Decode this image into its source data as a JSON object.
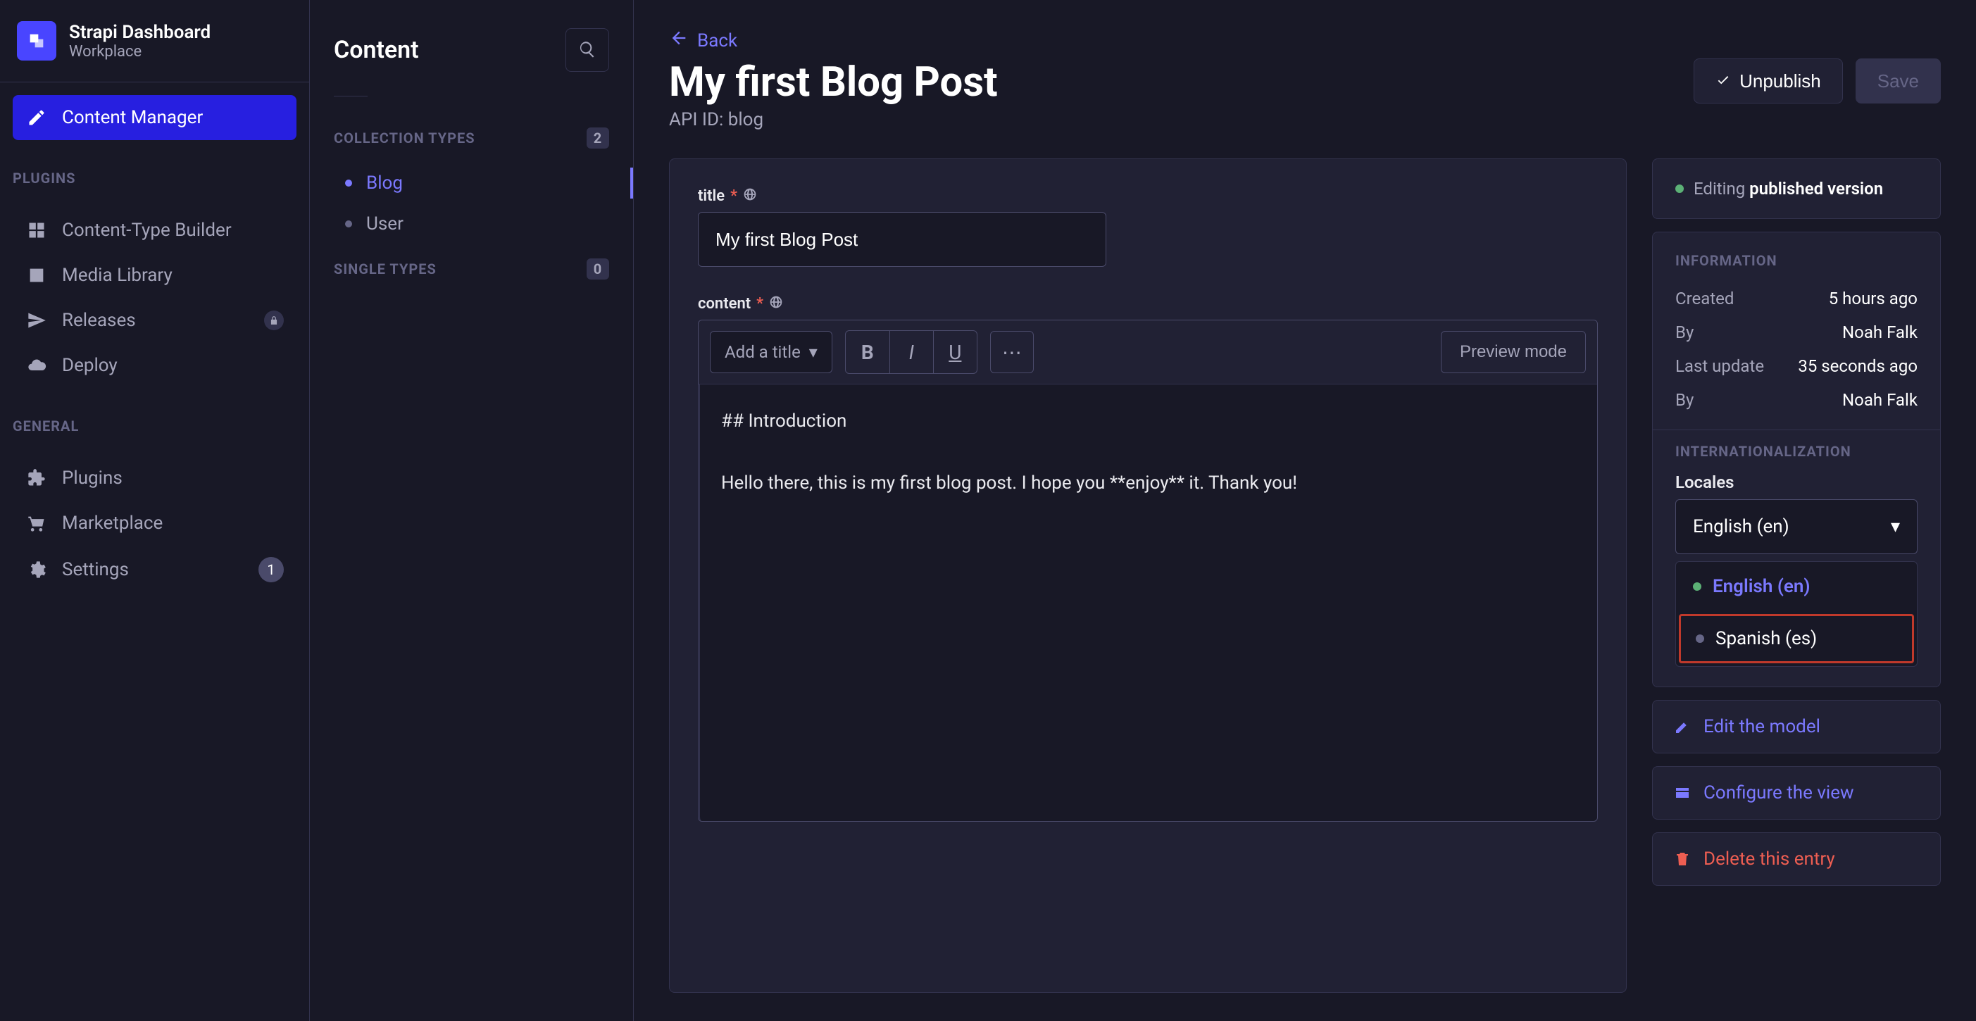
{
  "brand": {
    "title": "Strapi Dashboard",
    "subtitle": "Workplace"
  },
  "mainNav": {
    "contentManager": "Content Manager",
    "sections": {
      "plugins": "PLUGINS",
      "general": "GENERAL"
    },
    "items": {
      "contentTypeBuilder": "Content-Type Builder",
      "mediaLibrary": "Media Library",
      "releases": "Releases",
      "deploy": "Deploy",
      "plugins": "Plugins",
      "marketplace": "Marketplace",
      "settings": "Settings"
    },
    "settingsBadge": "1"
  },
  "secSidebar": {
    "title": "Content",
    "groups": {
      "collection": {
        "label": "COLLECTION TYPES",
        "count": "2"
      },
      "single": {
        "label": "SINGLE TYPES",
        "count": "0"
      }
    },
    "collectionItems": {
      "blog": "Blog",
      "user": "User"
    }
  },
  "page": {
    "back": "Back",
    "title": "My first Blog Post",
    "apiId": "API ID: blog",
    "unpublish": "Unpublish",
    "save": "Save"
  },
  "form": {
    "titleField": {
      "label": "title",
      "value": "My first Blog Post"
    },
    "contentField": {
      "label": "content"
    },
    "toolbar": {
      "titleSelect": "Add a title",
      "preview": "Preview mode"
    },
    "body": "## Introduction\n\nHello there, this is my first blog post. I hope you **enjoy** it. Thank you!"
  },
  "status": {
    "editing": "Editing",
    "published": "published version"
  },
  "info": {
    "heading": "INFORMATION",
    "created": {
      "label": "Created",
      "value": "5 hours ago"
    },
    "by1": {
      "label": "By",
      "value": "Noah Falk"
    },
    "lastUpdate": {
      "label": "Last update",
      "value": "35 seconds ago"
    },
    "by2": {
      "label": "By",
      "value": "Noah Falk"
    }
  },
  "i18n": {
    "heading": "INTERNATIONALIZATION",
    "localesLabel": "Locales",
    "selected": "English (en)",
    "options": {
      "en": "English (en)",
      "es": "Spanish (es)"
    }
  },
  "actions": {
    "editModel": "Edit the model",
    "configureView": "Configure the view",
    "deleteEntry": "Delete this entry"
  }
}
